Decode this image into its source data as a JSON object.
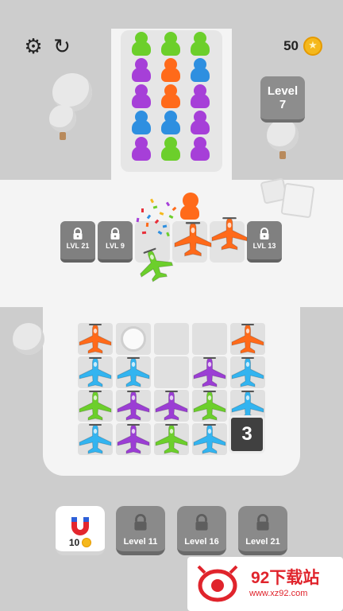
{
  "hud": {
    "coins": "50"
  },
  "level": {
    "line1": "Level",
    "line2": "7"
  },
  "queue": {
    "columns": [
      [
        "#6ccf2b",
        "#a63fd8",
        "#a63fd8",
        "#2e8fe0",
        "#a63fd8"
      ],
      [
        "#6ccf2b",
        "#ff6a1a",
        "#ff6a1a",
        "#2e8fe0",
        "#6ccf2b"
      ],
      [
        "#6ccf2b",
        "#2e8fe0",
        "#a63fd8",
        "#a63fd8",
        "#a63fd8"
      ]
    ]
  },
  "boarding_slots": [
    {
      "label": "LVL 21",
      "locked": true
    },
    {
      "label": "LVL 9",
      "locked": true
    },
    {
      "label": "",
      "locked": false
    },
    {
      "label": "",
      "locked": false
    },
    {
      "label": "",
      "locked": false
    },
    {
      "label": "LVL 13",
      "locked": true
    }
  ],
  "grid": {
    "rows": [
      [
        "orange",
        "empty-ring",
        "empty",
        "empty",
        "orange"
      ],
      [
        "blue",
        "blue",
        "empty",
        "purple",
        "blue"
      ],
      [
        "green",
        "purple",
        "purple",
        "green",
        "blue"
      ],
      [
        "blue",
        "purple",
        "green",
        "blue",
        ""
      ]
    ],
    "stack_count": "3"
  },
  "plane_colors": {
    "orange": "#ff6a1a",
    "blue": "#33b4f0",
    "green": "#6ccf2b",
    "purple": "#9b3ed4"
  },
  "bottom_bar": {
    "magnet_count": "10",
    "locked": [
      "Level 11",
      "Level 16",
      "Level 21"
    ]
  },
  "watermark": {
    "title": "92下载站",
    "url": "www.xz92.com"
  }
}
